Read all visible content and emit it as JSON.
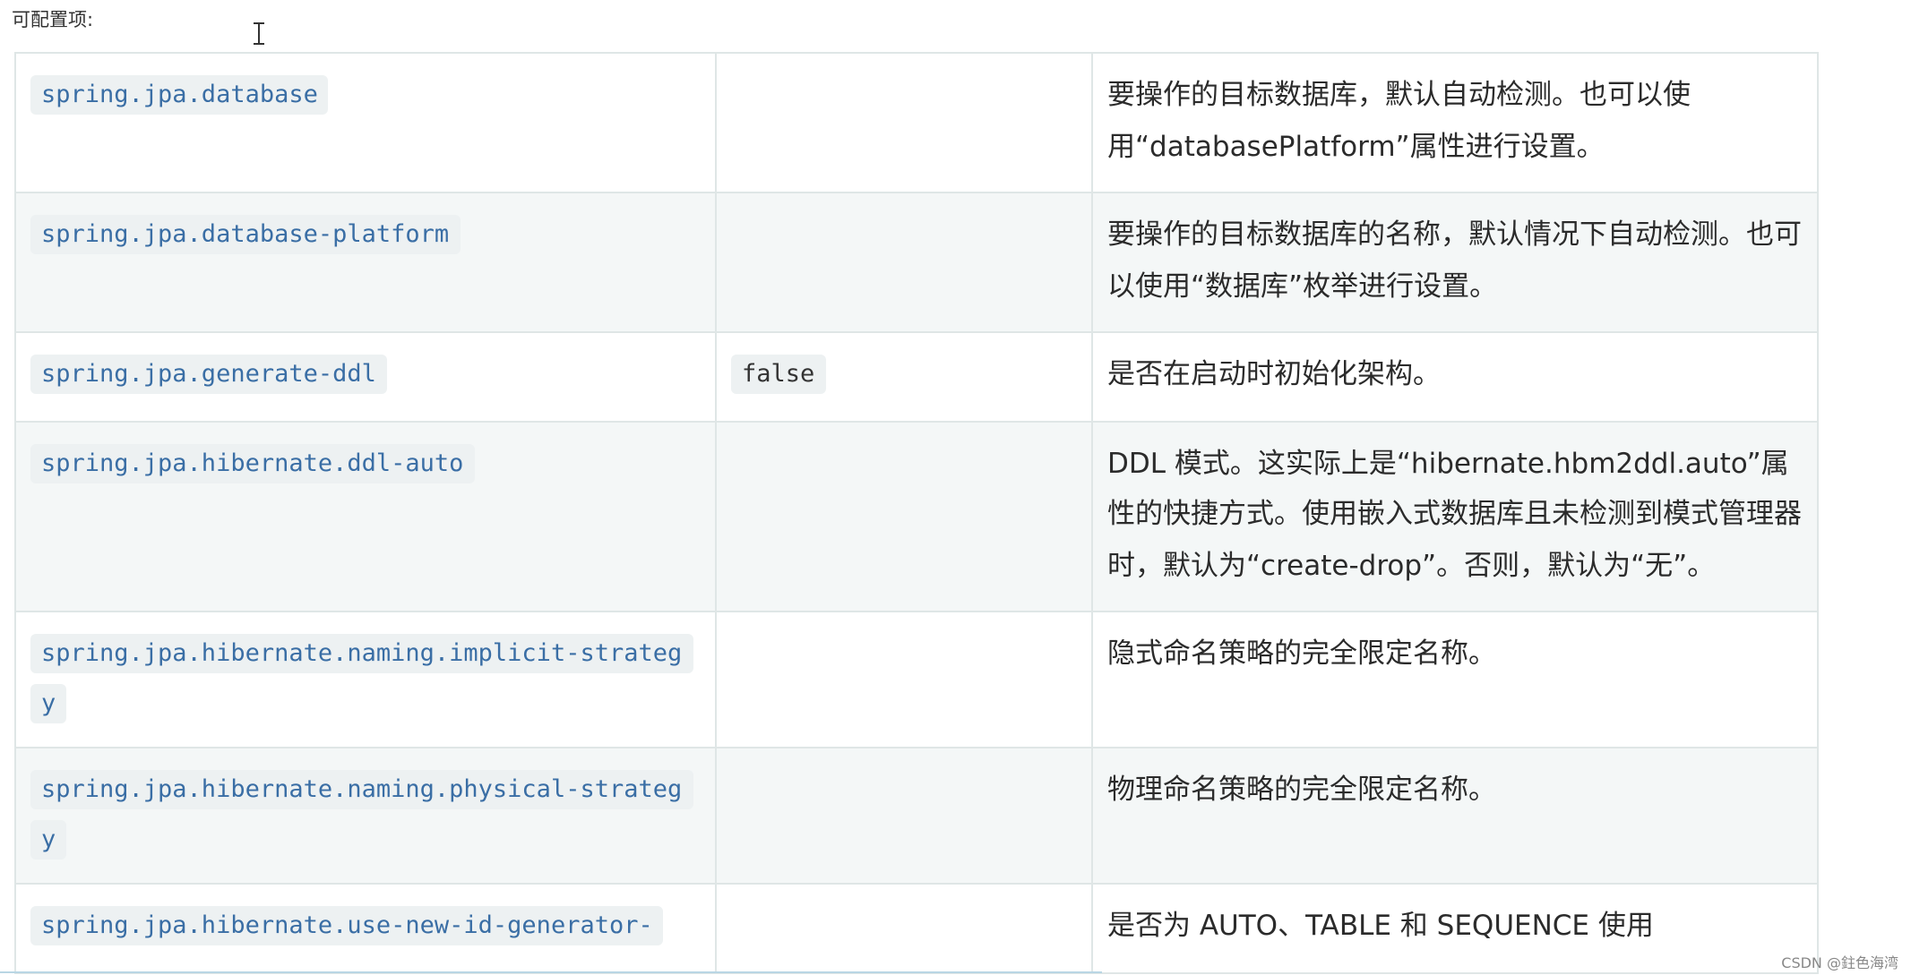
{
  "heading": "可配置项:",
  "rows": [
    {
      "property": "spring.jpa.database",
      "default": "",
      "description": "要操作的目标数据库，默认自动检测。也可以使用“databasePlatform”属性进行设置。"
    },
    {
      "property": "spring.jpa.database-platform",
      "default": "",
      "description": "要操作的目标数据库的名称，默认情况下自动检测。也可以使用“数据库”枚举进行设置。"
    },
    {
      "property": "spring.jpa.generate-ddl",
      "default": "false",
      "description": "是否在启动时初始化架构。"
    },
    {
      "property": "spring.jpa.hibernate.ddl-auto",
      "default": "",
      "description": "DDL 模式。这实际上是“hibernate.hbm2ddl.auto”属性的快捷方式。使用嵌入式数据库且未检测到模式管理器时，默认为“create-drop”。否则，默认为“无”。"
    },
    {
      "property": "spring.jpa.hibernate.naming.implicit-strategy",
      "default": "",
      "description": "隐式命名策略的完全限定名称。"
    },
    {
      "property": "spring.jpa.hibernate.naming.physical-strategy",
      "default": "",
      "description": "物理命名策略的完全限定名称。"
    },
    {
      "property": "spring.jpa.hibernate.use-new-id-generator-",
      "default": "",
      "description": "是否为 AUTO、TABLE 和 SEQUENCE 使用"
    }
  ],
  "watermark": "CSDN @鉒色海湾"
}
